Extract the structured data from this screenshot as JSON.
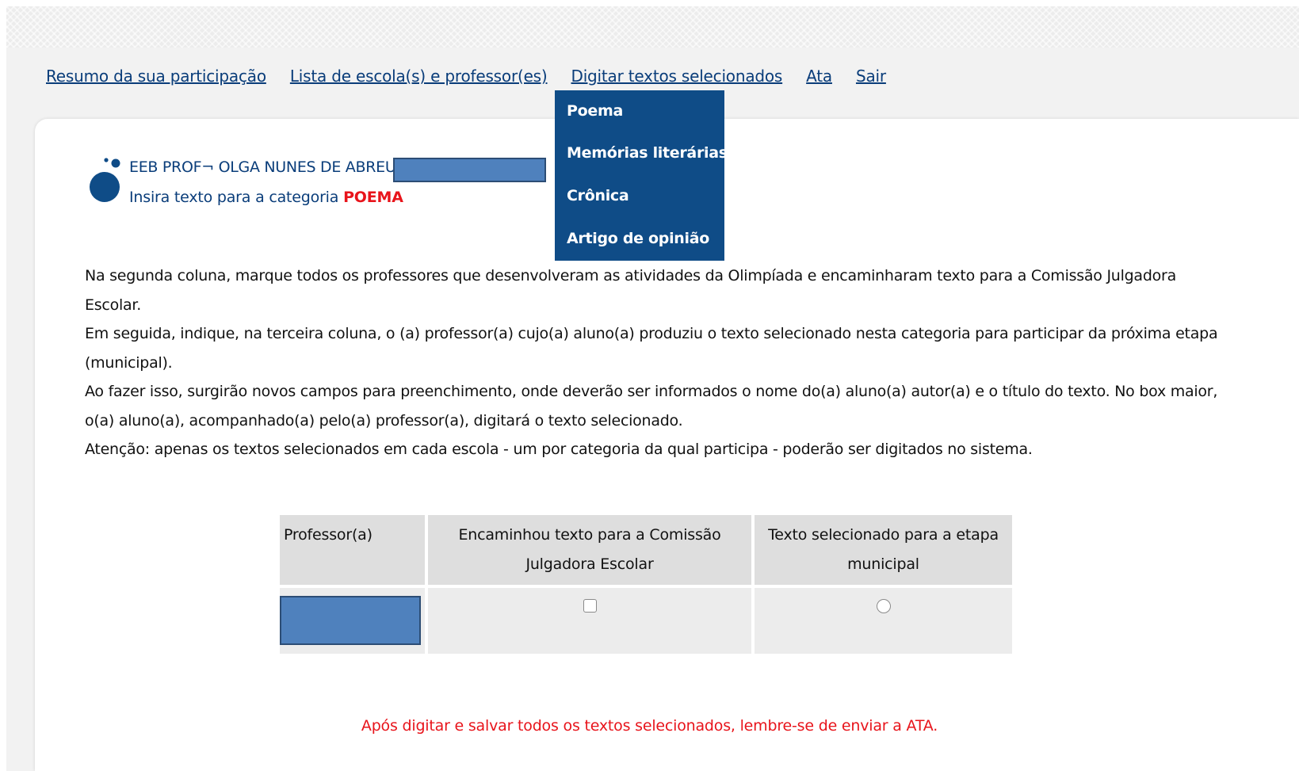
{
  "nav": {
    "items": [
      "Resumo da sua participação",
      "Lista de escola(s) e professor(es)",
      "Digitar textos selecionados",
      "Ata",
      "Sair"
    ]
  },
  "dropdown": {
    "items": [
      "Poema",
      "Memórias literárias",
      "Crônica",
      "Artigo de opinião"
    ]
  },
  "header": {
    "school_prefix": "EEB PROF¬ OLGA NUNES DE ABREU -",
    "category_prefix": "Insira texto para a categoria",
    "category": "POEMA"
  },
  "instructions": [
    "Na segunda coluna, marque todos os professores que desenvolveram as atividades da Olimpíada e encaminharam texto para a Comissão Julgadora Escolar.",
    "Em seguida, indique, na terceira coluna, o (a) professor(a) cujo(a) aluno(a) produziu o texto selecionado nesta categoria para participar da próxima etapa (municipal).",
    "Ao fazer isso, surgirão novos campos para preenchimento, onde deverão ser informados o nome do(a) aluno(a) autor(a) e o título do texto. No box maior, o(a) aluno(a), acompanhado(a) pelo(a) professor(a), digitará o texto selecionado.",
    "Atenção: apenas os textos selecionados em cada escola - um por categoria da qual participa - poderão ser digitados no sistema."
  ],
  "table": {
    "headers": [
      "Professor(a)",
      "Encaminhou texto para a Comissão Julgadora Escolar",
      "Texto selecionado para a etapa municipal"
    ]
  },
  "footer_note": "Após digitar e salvar todos os textos selecionados, lembre-se de enviar a ATA.",
  "colors": {
    "link": "#0a3d7a",
    "dropdown_bg": "#0f4c87",
    "alert_red": "#e8141b",
    "redaction": "#4f81bd"
  }
}
